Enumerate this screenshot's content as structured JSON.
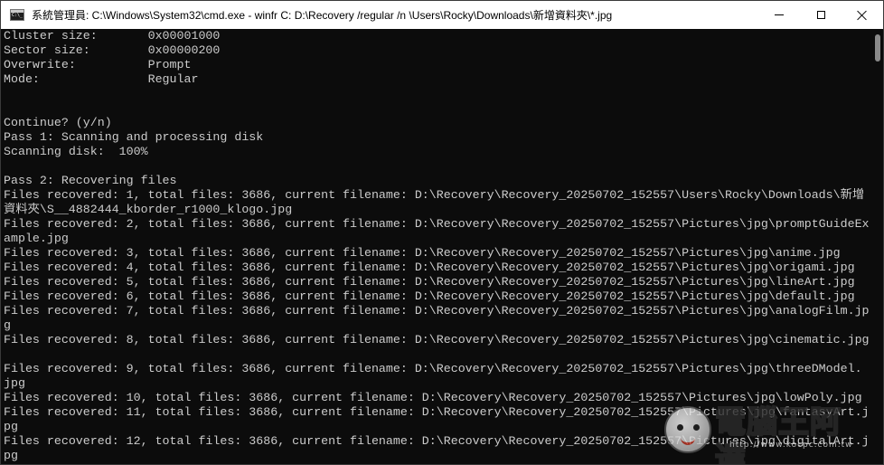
{
  "window": {
    "title": "系統管理員: C:\\Windows\\System32\\cmd.exe - winfr  C: D:\\Recovery /regular /n \\Users\\Rocky\\Downloads\\新增資料夾\\*.jpg",
    "icon": "cmd-icon"
  },
  "console": {
    "lines": [
      "Cluster size:       0x00001000",
      "Sector size:        0x00000200",
      "Overwrite:          Prompt",
      "Mode:               Regular",
      "",
      "",
      "Continue? (y/n)",
      "Pass 1: Scanning and processing disk",
      "Scanning disk:  100%",
      "",
      "Pass 2: Recovering files",
      "Files recovered: 1, total files: 3686, current filename: D:\\Recovery\\Recovery_20250702_152557\\Users\\Rocky\\Downloads\\新增",
      "資料夾\\S__4882444_kborder_r1000_klogo.jpg",
      "Files recovered: 2, total files: 3686, current filename: D:\\Recovery\\Recovery_20250702_152557\\Pictures\\jpg\\promptGuideEx",
      "ample.jpg",
      "Files recovered: 3, total files: 3686, current filename: D:\\Recovery\\Recovery_20250702_152557\\Pictures\\jpg\\anime.jpg",
      "Files recovered: 4, total files: 3686, current filename: D:\\Recovery\\Recovery_20250702_152557\\Pictures\\jpg\\origami.jpg",
      "Files recovered: 5, total files: 3686, current filename: D:\\Recovery\\Recovery_20250702_152557\\Pictures\\jpg\\lineArt.jpg",
      "Files recovered: 6, total files: 3686, current filename: D:\\Recovery\\Recovery_20250702_152557\\Pictures\\jpg\\default.jpg",
      "Files recovered: 7, total files: 3686, current filename: D:\\Recovery\\Recovery_20250702_152557\\Pictures\\jpg\\analogFilm.jp",
      "g",
      "Files recovered: 8, total files: 3686, current filename: D:\\Recovery\\Recovery_20250702_152557\\Pictures\\jpg\\cinematic.jpg",
      "",
      "Files recovered: 9, total files: 3686, current filename: D:\\Recovery\\Recovery_20250702_152557\\Pictures\\jpg\\threeDModel.",
      "jpg",
      "Files recovered: 10, total files: 3686, current filename: D:\\Recovery\\Recovery_20250702_152557\\Pictures\\jpg\\lowPoly.jpg",
      "Files recovered: 11, total files: 3686, current filename: D:\\Recovery\\Recovery_20250702_152557\\Pictures\\jpg\\fantasyArt.j",
      "pg",
      "Files recovered: 12, total files: 3686, current filename: D:\\Recovery\\Recovery_20250702_152557\\Pictures\\jpg\\digitalArt.j",
      "pg"
    ]
  },
  "watermark": {
    "text": "電腦王阿達",
    "url": "http://www.kocpc.com.tw"
  },
  "colors": {
    "console_bg": "#0c0c0c",
    "console_fg": "#cccccc",
    "titlebar_bg": "#ffffff"
  }
}
